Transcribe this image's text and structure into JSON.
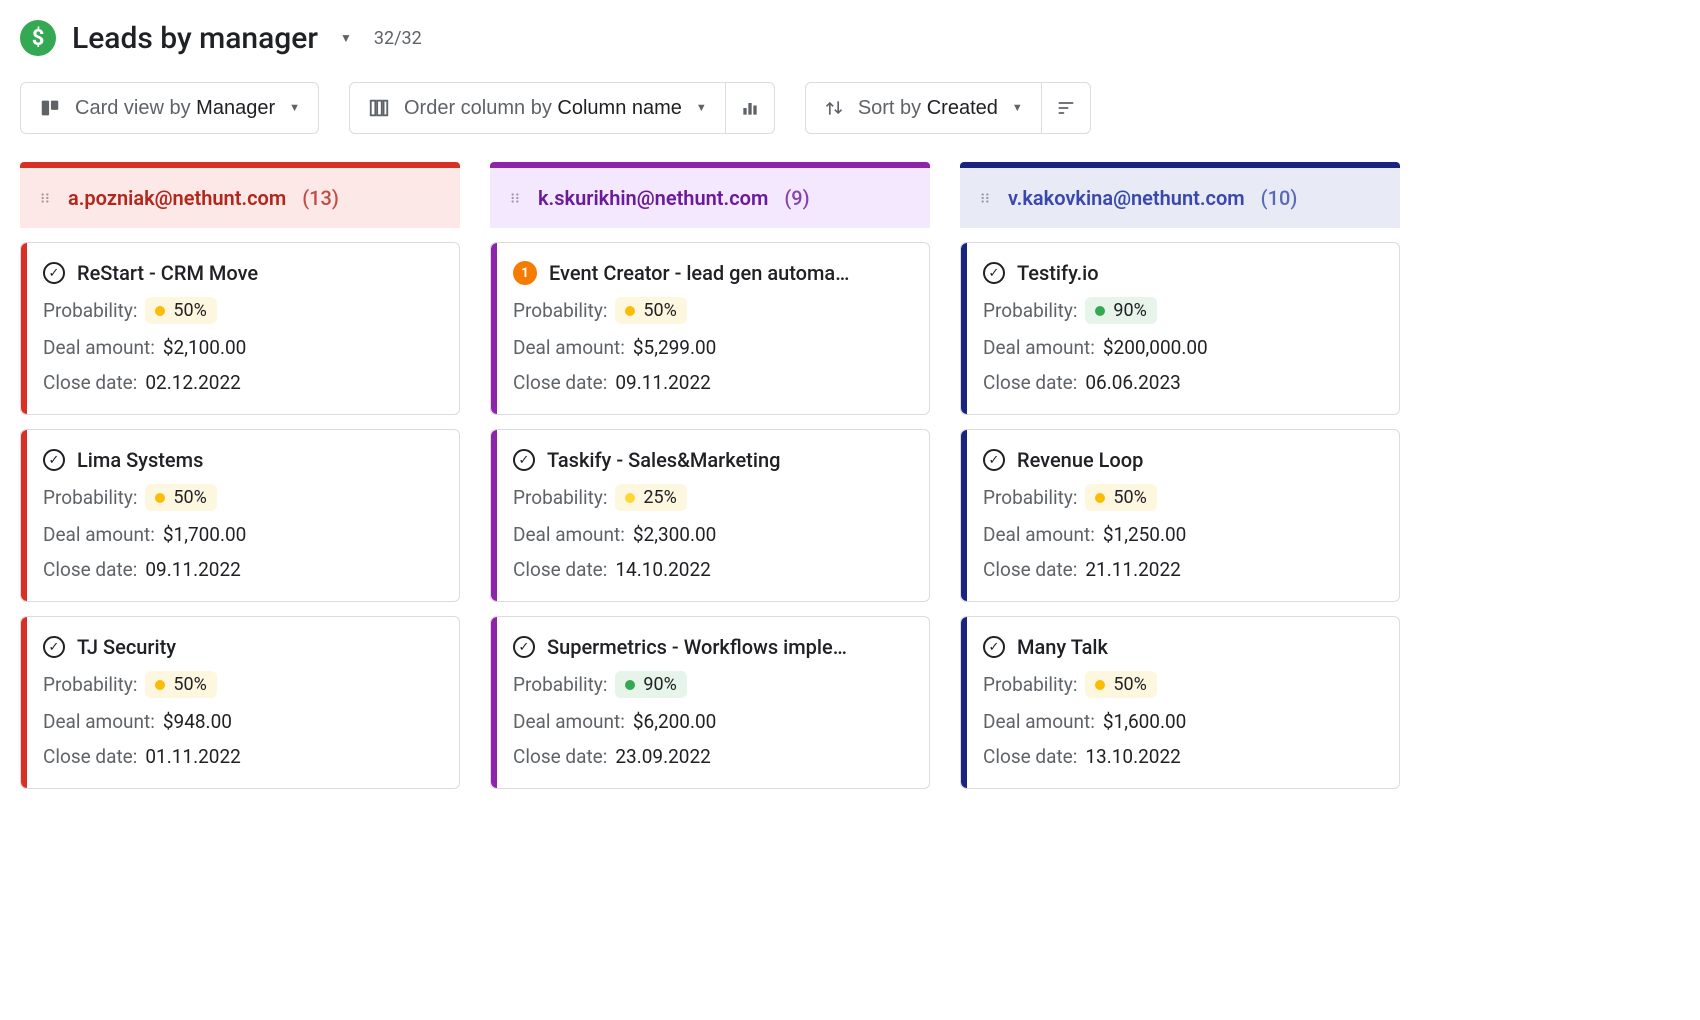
{
  "header": {
    "title": "Leads by manager",
    "count": "32/32"
  },
  "toolbar": {
    "view_prefix": "Card view by",
    "view_value": "Manager",
    "order_prefix": "Order column by",
    "order_value": "Column name",
    "sort_prefix": "Sort by",
    "sort_value": "Created"
  },
  "labels": {
    "probability": "Probability:",
    "deal_amount": "Deal amount:",
    "close_date": "Close date:"
  },
  "columns": [
    {
      "id": "red",
      "email": "a.pozniak@nethunt.com",
      "count": "(13)",
      "cards": [
        {
          "status": "check",
          "title": "ReStart - CRM Move",
          "prob": "50%",
          "prob_color": "orange",
          "amount": "$2,100.00",
          "close": "02.12.2022"
        },
        {
          "status": "check",
          "title": "Lima Systems",
          "prob": "50%",
          "prob_color": "orange",
          "amount": "$1,700.00",
          "close": "09.11.2022"
        },
        {
          "status": "check",
          "title": "TJ Security",
          "prob": "50%",
          "prob_color": "orange",
          "amount": "$948.00",
          "close": "01.11.2022"
        }
      ]
    },
    {
      "id": "purple",
      "email": "k.skurikhin@nethunt.com",
      "count": "(9)",
      "cards": [
        {
          "status": "badge",
          "badge": "1",
          "title": "Event Creator - lead gen automa…",
          "prob": "50%",
          "prob_color": "orange",
          "amount": "$5,299.00",
          "close": "09.11.2022"
        },
        {
          "status": "check",
          "title": "Taskify - Sales&Marketing",
          "prob": "25%",
          "prob_color": "yellow",
          "amount": "$2,300.00",
          "close": "14.10.2022"
        },
        {
          "status": "check",
          "title": "Supermetrics - Workflows imple…",
          "prob": "90%",
          "prob_color": "green",
          "amount": "$6,200.00",
          "close": "23.09.2022"
        }
      ]
    },
    {
      "id": "blue",
      "email": "v.kakovkina@nethunt.com",
      "count": "(10)",
      "cards": [
        {
          "status": "check",
          "title": "Testify.io",
          "prob": "90%",
          "prob_color": "green",
          "amount": "$200,000.00",
          "close": "06.06.2023"
        },
        {
          "status": "check",
          "title": "Revenue Loop",
          "prob": "50%",
          "prob_color": "orange",
          "amount": "$1,250.00",
          "close": "21.11.2022"
        },
        {
          "status": "check",
          "title": "Many Talk",
          "prob": "50%",
          "prob_color": "orange",
          "amount": "$1,600.00",
          "close": "13.10.2022"
        }
      ]
    }
  ]
}
